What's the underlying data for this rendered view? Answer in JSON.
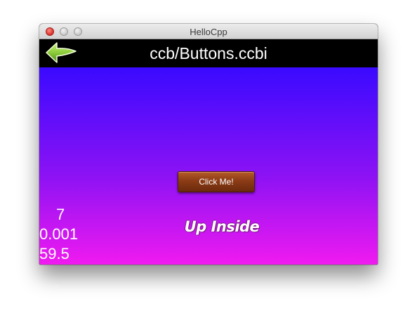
{
  "window": {
    "title": "HelloCpp"
  },
  "header": {
    "scene_title": "ccb/Buttons.ccbi",
    "back_icon": "back-arrow-icon"
  },
  "scene": {
    "button_label": "Click Me!",
    "status_text": "Up Inside"
  },
  "stats": {
    "draw_calls": "7",
    "frame_time": "0.001",
    "fps": "59.5"
  },
  "colors": {
    "stage_top": "#3a0aff",
    "stage_bottom": "#f01af0",
    "button": "#8c3c16",
    "back_arrow": "#8ccc3a"
  }
}
